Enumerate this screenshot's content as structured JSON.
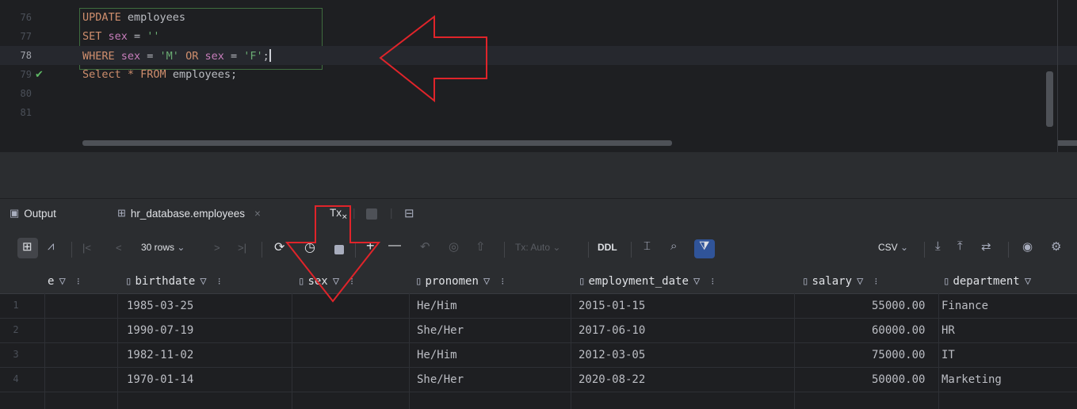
{
  "editor": {
    "lines": [
      {
        "num": "76"
      },
      {
        "num": "77"
      },
      {
        "num": "78"
      },
      {
        "num": "79"
      },
      {
        "num": "80"
      },
      {
        "num": "81"
      }
    ],
    "code": {
      "l76_kw": "UPDATE",
      "l76_rest": " employees",
      "l77_kw": "SET",
      "l77_id": " sex",
      "l77_eq": " = ",
      "l77_str": "''",
      "l78_kw": "WHERE",
      "l78_id1": " sex",
      "l78_eq1": " = ",
      "l78_str1": "'M'",
      "l78_or": " OR",
      "l78_id2": " sex",
      "l78_eq2": " = ",
      "l78_str2": "'F'",
      "l78_semi": ";",
      "l79_kw1": "Select",
      "l79_star": " * ",
      "l79_kw2": "FROM",
      "l79_rest": " employees;"
    },
    "check_icon": "check-icon"
  },
  "tabs": {
    "output": "Output",
    "table": "hr_database.employees",
    "tx": "Tx"
  },
  "toolbar": {
    "rows": "30 rows",
    "tx_auto": "Tx: Auto",
    "ddl": "DDL",
    "csv": "CSV"
  },
  "grid": {
    "columns": [
      "e",
      "birthdate",
      "sex",
      "pronomen",
      "employment_date",
      "salary",
      "department"
    ],
    "rows": [
      {
        "n": "1",
        "birthdate": "1985-03-25",
        "sex": "",
        "pronomen": "He/Him",
        "employment_date": "2015-01-15",
        "salary": "55000.00",
        "department": "Finance"
      },
      {
        "n": "2",
        "birthdate": "1990-07-19",
        "sex": "",
        "pronomen": "She/Her",
        "employment_date": "2017-06-10",
        "salary": "60000.00",
        "department": "HR"
      },
      {
        "n": "3",
        "birthdate": "1982-11-02",
        "sex": "",
        "pronomen": "He/Him",
        "employment_date": "2012-03-05",
        "salary": "75000.00",
        "department": "IT"
      },
      {
        "n": "4",
        "birthdate": "1970-01-14",
        "sex": "",
        "pronomen": "She/Her",
        "employment_date": "2020-08-22",
        "salary": "50000.00",
        "department": "Marketing"
      }
    ]
  },
  "colors": {
    "annotation": "#e0242a",
    "keyword": "#cf8e6d",
    "string": "#6aab73",
    "identifier": "#c77dbb"
  }
}
